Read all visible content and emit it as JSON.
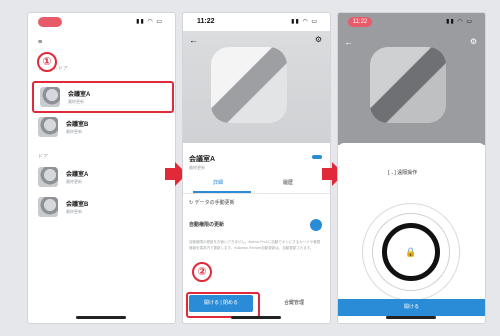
{
  "screen1": {
    "status": {
      "time": ""
    },
    "section_smart": "スマートドア",
    "section_door": "ドア",
    "locks": [
      {
        "name": "会議室A",
        "sub": "最終更新"
      },
      {
        "name": "会議室B",
        "sub": "最終更新"
      },
      {
        "name": "会議室A",
        "sub": "最終更新"
      },
      {
        "name": "会議室B",
        "sub": "最終更新"
      }
    ],
    "step_badge": "①"
  },
  "screen2": {
    "status": {
      "time": "11:22"
    },
    "title": "会議室A",
    "subtitle": "最終更新",
    "tabs": [
      "詳細",
      "履歴"
    ],
    "row_auto_lock": "データの手動更新",
    "row_permission": "自動権限の更新",
    "description": "自動権限の更新をお使いできません。Akerun Pro2に自動でオンにするカードや権限情報を端末内で更新します。※Akerun Remote自動更新は、自動更新されます。",
    "btn_open_close": "開ける | 閉める",
    "btn_key_manage": "合鍵管理",
    "step_badge": "②"
  },
  "screen3": {
    "status": {
      "time": "11:22"
    },
    "hands_free_label": "[→] 遠隔操作",
    "btn_open": "開ける"
  },
  "colors": {
    "accent": "#2a8bd6",
    "highlight": "#e02a3a"
  }
}
